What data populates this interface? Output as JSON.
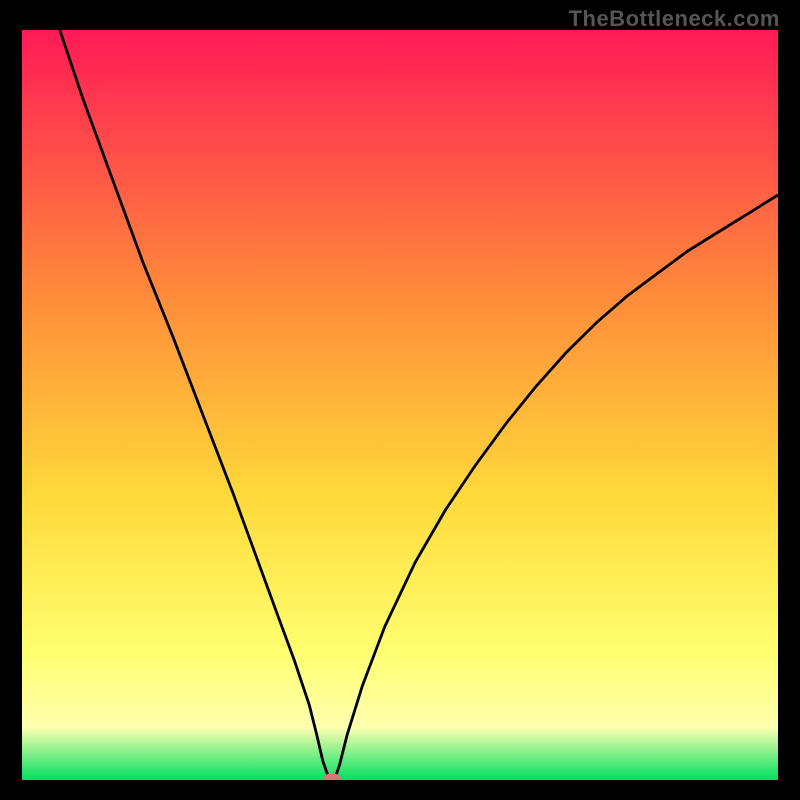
{
  "watermark": "TheBottleneck.com",
  "chart_data": {
    "type": "line",
    "title": "",
    "xlabel": "",
    "ylabel": "",
    "xlim": [
      0,
      100
    ],
    "ylim": [
      0,
      100
    ],
    "legend": false,
    "grid": false,
    "background_gradient": {
      "top_color": "#ff1a56",
      "upper_mid_color": "#ff8a3a",
      "mid_color": "#ffd93a",
      "lower_mid_color": "#ffff70",
      "near_bottom_color": "#ffffb0",
      "bottom_color": "#00e060"
    },
    "series": [
      {
        "name": "bottleneck_curve",
        "x": [
          5,
          8,
          12,
          16,
          20,
          24,
          28,
          32,
          34,
          36,
          38,
          39,
          39.8,
          40.5,
          41,
          41.5,
          42,
          43,
          45,
          48,
          52,
          56,
          60,
          64,
          68,
          72,
          76,
          80,
          84,
          88,
          92,
          96,
          100
        ],
        "y": [
          100,
          91,
          80,
          69,
          59,
          48.5,
          38,
          27,
          21.5,
          16,
          10,
          6,
          2.5,
          0.5,
          0,
          0.5,
          2,
          6,
          12.5,
          20.5,
          29,
          36,
          42,
          47.5,
          52.5,
          57,
          61,
          64.5,
          67.5,
          70.5,
          73,
          75.5,
          78
        ]
      }
    ],
    "min_point": {
      "x": 41,
      "y": 0,
      "color": "#cf7a7a"
    }
  }
}
